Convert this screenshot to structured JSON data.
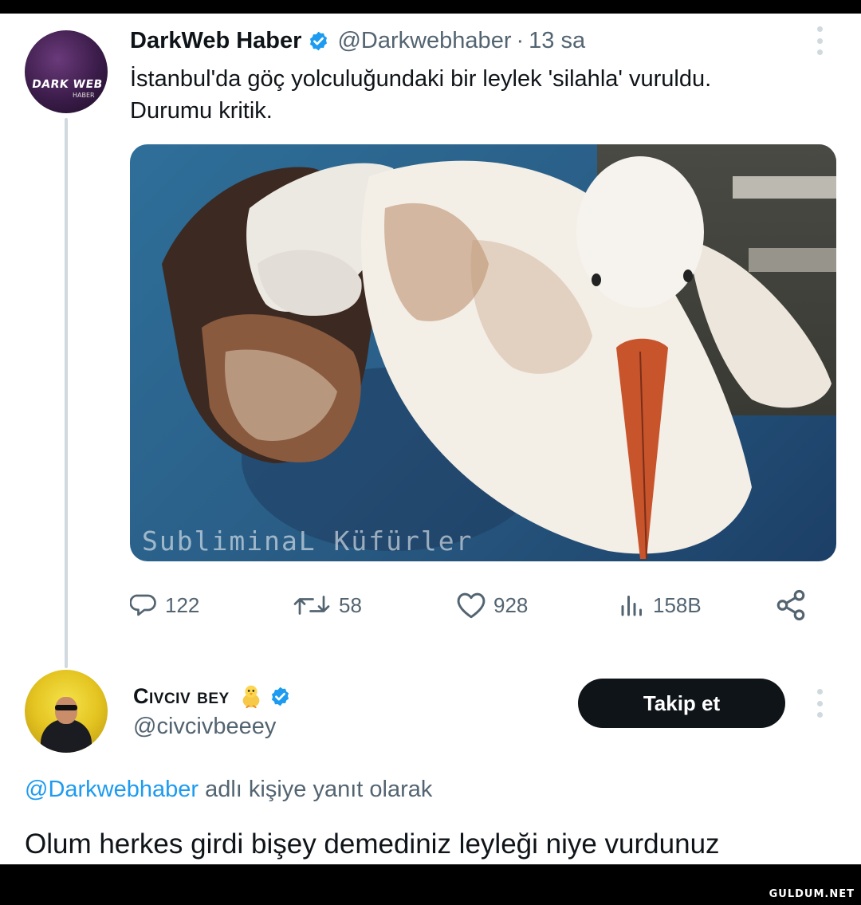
{
  "tweet": {
    "author_name": "DarkWeb Haber",
    "handle": "@Darkwebhaber",
    "separator": "·",
    "time": "13 sa",
    "avatar_text_main": "DARK WEB",
    "avatar_text_sub": "HABER",
    "text_lines": [
      "İstanbul'da göç yolculuğundaki bir leylek 'silahla' vuruldu.",
      "Durumu kritik."
    ],
    "image_watermark": "SubliminaL Küfürler",
    "actions": {
      "replies": "122",
      "retweets": "58",
      "likes": "928",
      "views": "158B"
    }
  },
  "reply": {
    "author_name": "Cıvcıv bey",
    "handle": "@civcivbeeey",
    "follow_label": "Takip et",
    "reply_to_mention": "@Darkwebhaber",
    "reply_to_suffix": " adlı kişiye yanıt olarak",
    "text": "Olum herkes girdi bişey demediniz leyleği niye vurdunuz"
  },
  "footer": {
    "watermark": "GULDUM.NET"
  },
  "colors": {
    "text": "#0f1419",
    "secondary": "#536471",
    "accent": "#1d9bf0",
    "button": "#0f1419"
  }
}
